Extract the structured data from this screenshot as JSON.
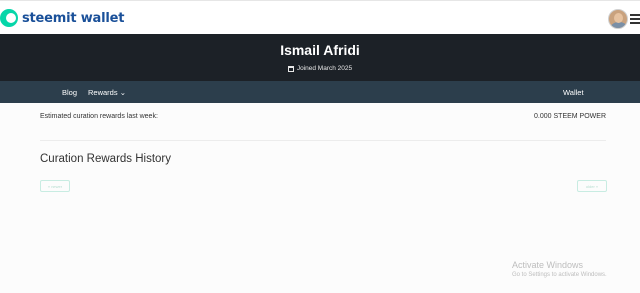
{
  "brand": {
    "logo_text": "steemit wallet"
  },
  "header": {
    "user_name": "Ismail Afridi",
    "joined": "Joined March 2025"
  },
  "nav": {
    "blog": "Blog",
    "rewards": "Rewards",
    "rewards_caret": "⌄",
    "wallet": "Wallet"
  },
  "summary": {
    "label": "Estimated curation rewards last week:",
    "value": "0.000 STEEM POWER"
  },
  "history": {
    "title": "Curation Rewards History",
    "newer": "« newer",
    "older": "older »"
  },
  "overlay": {
    "line1": "Activate Windows",
    "line2": "Go to Settings to activate Windows."
  }
}
